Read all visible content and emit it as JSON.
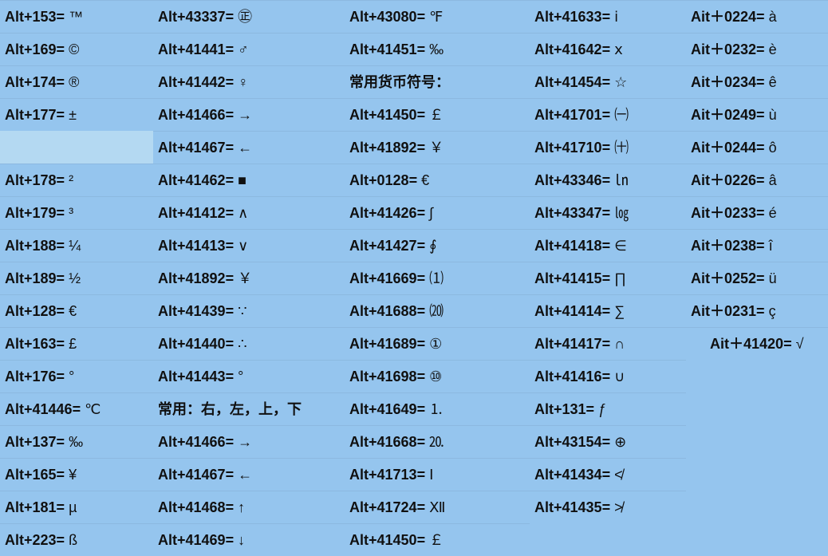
{
  "columns": [
    {
      "rows": [
        {
          "code": "Alt+153",
          "sym": "™"
        },
        {
          "code": "Alt+169",
          "sym": "©"
        },
        {
          "code": "Alt+174",
          "sym": "®"
        },
        {
          "code": "Alt+177",
          "sym": "±"
        },
        {
          "code": "",
          "sym": "",
          "blank": true
        },
        {
          "code": "Alt+178",
          "sym": "²"
        },
        {
          "code": "Alt+179",
          "sym": "³"
        },
        {
          "code": "Alt+188",
          "sym": "¼"
        },
        {
          "code": "Alt+189",
          "sym": "½"
        },
        {
          "code": "Alt+128",
          "sym": "€"
        },
        {
          "code": "Alt+163",
          "sym": "£"
        },
        {
          "code": "Alt+176",
          "sym": "°"
        },
        {
          "code": "Alt+41446",
          "sym": "℃"
        },
        {
          "code": "Alt+137",
          "sym": "‰"
        },
        {
          "code": "Alt+165",
          "sym": "¥"
        },
        {
          "code": "Alt+181",
          "sym": "µ"
        },
        {
          "code": "Alt+223",
          "sym": "ß"
        }
      ]
    },
    {
      "rows": [
        {
          "code": "Alt+43337",
          "sym": "㊣"
        },
        {
          "code": "Alt+41441",
          "sym": "♂"
        },
        {
          "code": "Alt+41442",
          "sym": "♀"
        },
        {
          "code": "Alt+41466",
          "sym": "→"
        },
        {
          "code": "Alt+41467",
          "sym": "←"
        },
        {
          "code": "Alt+41462",
          "sym": "■"
        },
        {
          "code": "Alt+41412",
          "sym": "∧"
        },
        {
          "code": "Alt+41413",
          "sym": "∨"
        },
        {
          "code": "Alt+41892",
          "sym": "￥"
        },
        {
          "code": "Alt+41439",
          "sym": "∵"
        },
        {
          "code": "Alt+41440",
          "sym": "∴"
        },
        {
          "code": "Alt+41443",
          "sym": "°"
        },
        {
          "label": "常用：右，左，上，下"
        },
        {
          "code": "Alt+41466",
          "sym": "→"
        },
        {
          "code": "Alt+41467",
          "sym": "←"
        },
        {
          "code": "Alt+41468",
          "sym": "↑"
        },
        {
          "code": "Alt+41469",
          "sym": "↓"
        }
      ]
    },
    {
      "rows": [
        {
          "code": "Alt+43080",
          "sym": "℉"
        },
        {
          "code": "Alt+41451",
          "sym": "‰"
        },
        {
          "label": "常用货币符号："
        },
        {
          "code": "Alt+41450",
          "sym": "￡"
        },
        {
          "code": "Alt+41892",
          "sym": "￥"
        },
        {
          "code": "Alt+0128",
          "sym": "€"
        },
        {
          "code": "Alt+41426",
          "sym": "∫"
        },
        {
          "code": "Alt+41427",
          "sym": "∮"
        },
        {
          "code": "Alt+41669",
          "sym": "⑴"
        },
        {
          "code": "Alt+41688",
          "sym": "⒇"
        },
        {
          "code": "Alt+41689",
          "sym": "①"
        },
        {
          "code": "Alt+41698",
          "sym": "⑩"
        },
        {
          "code": "Alt+41649",
          "sym": "⒈"
        },
        {
          "code": "Alt+41668",
          "sym": "⒛"
        },
        {
          "code": "Alt+41713",
          "sym": "Ⅰ"
        },
        {
          "code": "Alt+41724",
          "sym": "Ⅻ"
        },
        {
          "code": "Alt+41450",
          "sym": "￡"
        }
      ]
    },
    {
      "rows": [
        {
          "code": "Alt+41633",
          "sym": "ⅰ"
        },
        {
          "code": "Alt+41642",
          "sym": "ⅹ"
        },
        {
          "code": "Alt+41454",
          "sym": "☆"
        },
        {
          "code": "Alt+41701",
          "sym": "㈠"
        },
        {
          "code": "Alt+41710",
          "sym": "㈩"
        },
        {
          "code": "Alt+43346",
          "sym": "㏑"
        },
        {
          "code": "Alt+43347",
          "sym": "㏒"
        },
        {
          "code": "Alt+41418",
          "sym": "∈"
        },
        {
          "code": "Alt+41415",
          "sym": "∏"
        },
        {
          "code": "Alt+41414",
          "sym": "∑"
        },
        {
          "code": "Alt+41417",
          "sym": "∩"
        },
        {
          "code": "Alt+41416",
          "sym": "∪"
        },
        {
          "code": "Alt+131",
          "sym": "ƒ"
        },
        {
          "code": "Alt+43154",
          "sym": "⊕"
        },
        {
          "code": "Alt+41434",
          "sym": "≮"
        },
        {
          "code": "Alt+41435",
          "sym": "≯"
        }
      ]
    },
    {
      "rows": [
        {
          "code": "Ait＋0224",
          "sym": "à"
        },
        {
          "code": "Ait＋0232",
          "sym": "è"
        },
        {
          "code": "Ait＋0234",
          "sym": "ê"
        },
        {
          "code": "Ait＋0249",
          "sym": "ù"
        },
        {
          "code": "Ait＋0244",
          "sym": "ô"
        },
        {
          "code": "Ait＋0226",
          "sym": "â"
        },
        {
          "code": "Ait＋0233",
          "sym": "é"
        },
        {
          "code": "Ait＋0238",
          "sym": "î"
        },
        {
          "code": "Ait＋0252",
          "sym": "ü"
        },
        {
          "code": "Ait＋0231",
          "sym": "ç"
        },
        {
          "code": "Ait＋41420",
          "sym": "√",
          "indent": true
        }
      ]
    }
  ]
}
